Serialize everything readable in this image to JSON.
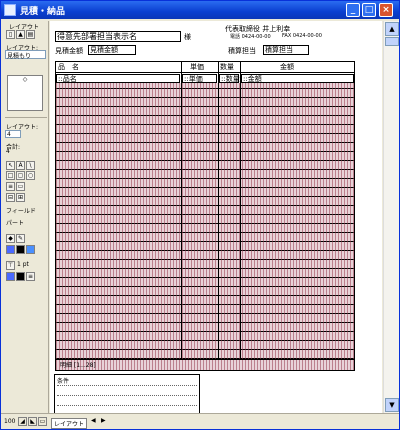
{
  "window": {
    "title": "見積・納品"
  },
  "palette": {
    "layout_label": "レイアウト",
    "layout_label2": "レイアウト:",
    "layout_select": "見積もり",
    "layout_label3": "レイアウト:",
    "layout_number": "4",
    "total_label": "合計:",
    "total_value": "4",
    "field_label": "フィールド",
    "part_label": "パート",
    "font_size": "1 pt"
  },
  "form": {
    "recipient": "得意先部署担当表示名",
    "honorific": "様",
    "quote_amount_label": "見積金額",
    "quote_amount_field": "見積金額",
    "representative": "代表取締役 井上利幸",
    "tel": "電話 0424-00-00",
    "fax": "FAX 0424-00-00",
    "estimator_label": "積算担当",
    "estimator_field": "積算担当",
    "columns": {
      "item": "品　名",
      "unit_price": "単価",
      "qty": "数量",
      "amount": "金額"
    },
    "row_fields": {
      "item": "::品名",
      "unit_price": "::単価",
      "qty": "::数量",
      "amount": "::金額"
    },
    "subtotal_label": "明細 [1...28]",
    "notes_label": "条件"
  },
  "statusbar": {
    "zoom": "100",
    "mode": "レイアウト"
  }
}
